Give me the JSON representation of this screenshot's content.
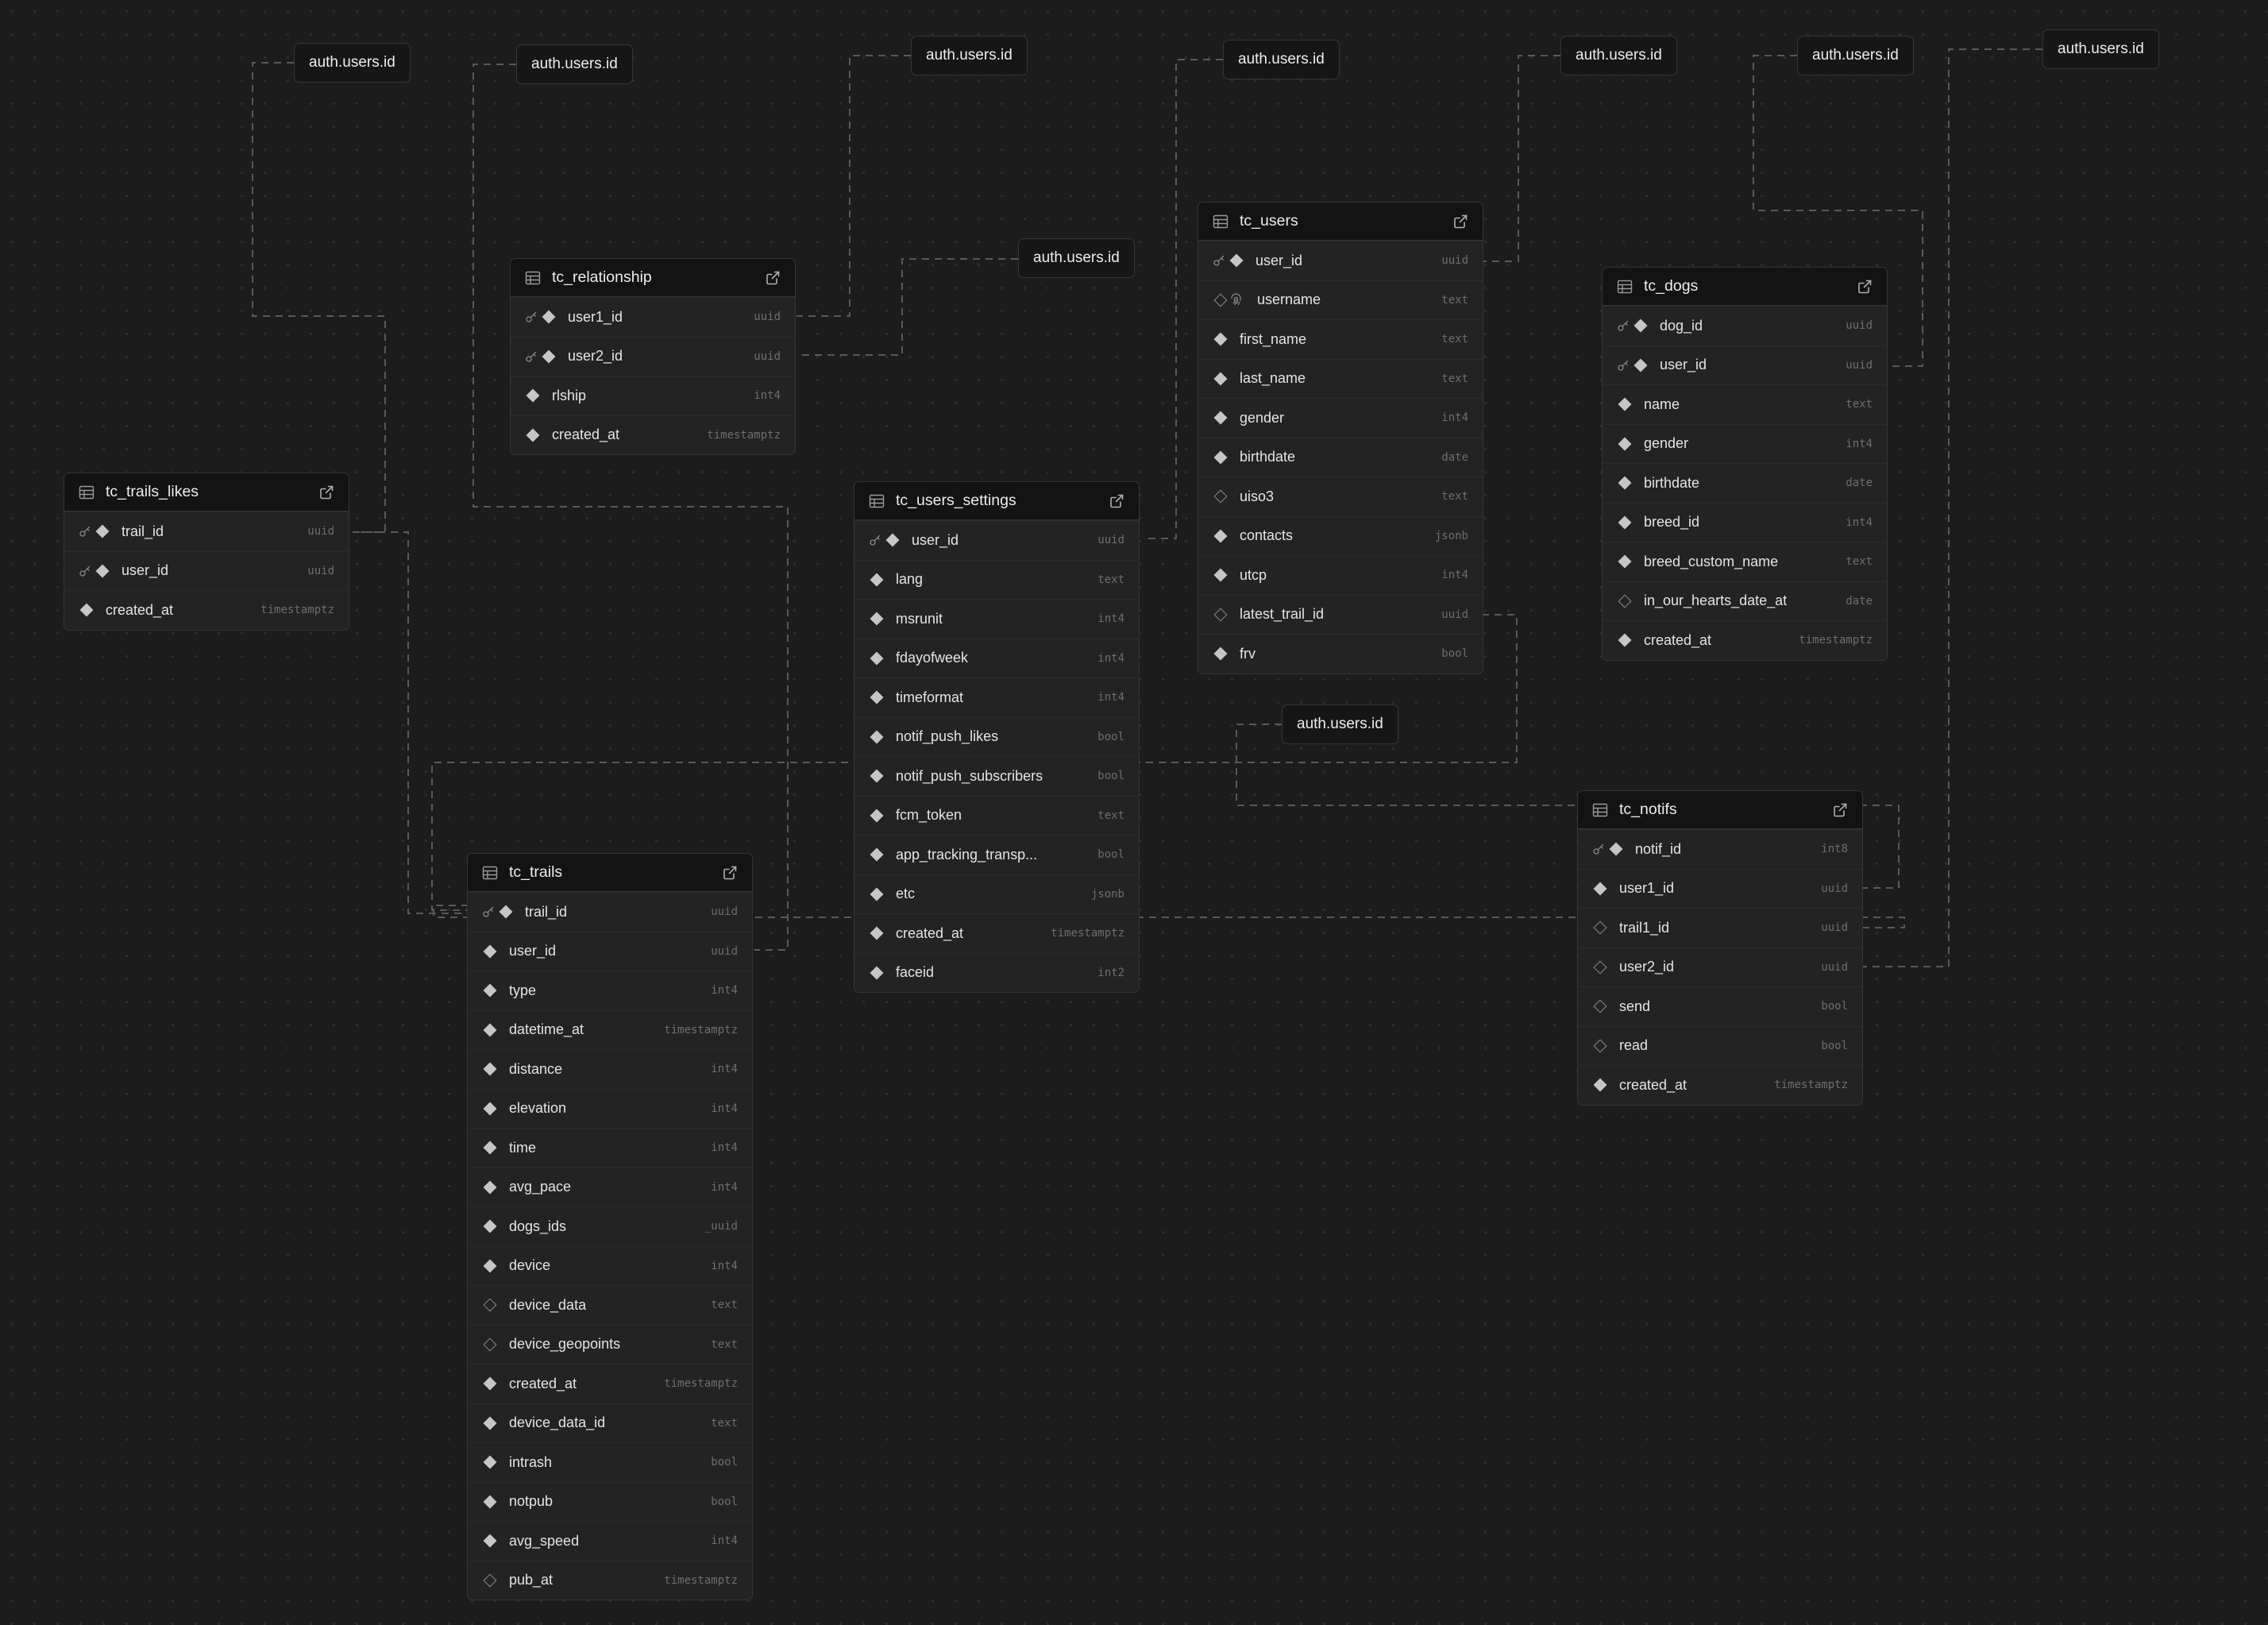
{
  "colors": {
    "background": "#1c1c1c",
    "card": "#232323",
    "card_header": "#131313",
    "border": "#353535",
    "edge": "#5a5a5a",
    "text": "#ededed",
    "type_text": "#6e6e6e"
  },
  "auth_refs": [
    "auth.users.id",
    "auth.users.id",
    "auth.users.id",
    "auth.users.id",
    "auth.users.id",
    "auth.users.id",
    "auth.users.id",
    "auth.users.id",
    "auth.users.id"
  ],
  "tables": [
    {
      "name": "tc_relationship",
      "columns": [
        {
          "name": "user1_id",
          "type": "uuid",
          "pk": true,
          "marker": "filled"
        },
        {
          "name": "user2_id",
          "type": "uuid",
          "pk": true,
          "marker": "filled"
        },
        {
          "name": "rlship",
          "type": "int4",
          "pk": false,
          "marker": "filled"
        },
        {
          "name": "created_at",
          "type": "timestamptz",
          "pk": false,
          "marker": "filled"
        }
      ]
    },
    {
      "name": "tc_users",
      "columns": [
        {
          "name": "user_id",
          "type": "uuid",
          "pk": true,
          "marker": "filled"
        },
        {
          "name": "username",
          "type": "text",
          "pk": false,
          "marker": "hollow",
          "unique_icon": "fingerprint-icon"
        },
        {
          "name": "first_name",
          "type": "text",
          "pk": false,
          "marker": "filled"
        },
        {
          "name": "last_name",
          "type": "text",
          "pk": false,
          "marker": "filled"
        },
        {
          "name": "gender",
          "type": "int4",
          "pk": false,
          "marker": "filled"
        },
        {
          "name": "birthdate",
          "type": "date",
          "pk": false,
          "marker": "filled"
        },
        {
          "name": "uiso3",
          "type": "text",
          "pk": false,
          "marker": "hollow"
        },
        {
          "name": "contacts",
          "type": "jsonb",
          "pk": false,
          "marker": "filled"
        },
        {
          "name": "utcp",
          "type": "int4",
          "pk": false,
          "marker": "filled"
        },
        {
          "name": "latest_trail_id",
          "type": "uuid",
          "pk": false,
          "marker": "hollow"
        },
        {
          "name": "frv",
          "type": "bool",
          "pk": false,
          "marker": "filled"
        }
      ]
    },
    {
      "name": "tc_dogs",
      "columns": [
        {
          "name": "dog_id",
          "type": "uuid",
          "pk": true,
          "marker": "filled"
        },
        {
          "name": "user_id",
          "type": "uuid",
          "pk": true,
          "marker": "filled"
        },
        {
          "name": "name",
          "type": "text",
          "pk": false,
          "marker": "filled"
        },
        {
          "name": "gender",
          "type": "int4",
          "pk": false,
          "marker": "filled"
        },
        {
          "name": "birthdate",
          "type": "date",
          "pk": false,
          "marker": "filled"
        },
        {
          "name": "breed_id",
          "type": "int4",
          "pk": false,
          "marker": "filled"
        },
        {
          "name": "breed_custom_name",
          "type": "text",
          "pk": false,
          "marker": "filled"
        },
        {
          "name": "in_our_hearts_date_at",
          "type": "date",
          "pk": false,
          "marker": "hollow"
        },
        {
          "name": "created_at",
          "type": "timestamptz",
          "pk": false,
          "marker": "filled"
        }
      ]
    },
    {
      "name": "tc_trails_likes",
      "columns": [
        {
          "name": "trail_id",
          "type": "uuid",
          "pk": true,
          "marker": "filled"
        },
        {
          "name": "user_id",
          "type": "uuid",
          "pk": true,
          "marker": "filled"
        },
        {
          "name": "created_at",
          "type": "timestamptz",
          "pk": false,
          "marker": "filled"
        }
      ]
    },
    {
      "name": "tc_users_settings",
      "columns": [
        {
          "name": "user_id",
          "type": "uuid",
          "pk": true,
          "marker": "filled"
        },
        {
          "name": "lang",
          "type": "text",
          "pk": false,
          "marker": "filled"
        },
        {
          "name": "msrunit",
          "type": "int4",
          "pk": false,
          "marker": "filled"
        },
        {
          "name": "fdayofweek",
          "type": "int4",
          "pk": false,
          "marker": "filled"
        },
        {
          "name": "timeformat",
          "type": "int4",
          "pk": false,
          "marker": "filled"
        },
        {
          "name": "notif_push_likes",
          "type": "bool",
          "pk": false,
          "marker": "filled"
        },
        {
          "name": "notif_push_subscribers",
          "type": "bool",
          "pk": false,
          "marker": "filled"
        },
        {
          "name": "fcm_token",
          "type": "text",
          "pk": false,
          "marker": "filled"
        },
        {
          "name": "app_tracking_transp...",
          "type": "bool",
          "pk": false,
          "marker": "filled"
        },
        {
          "name": "etc",
          "type": "jsonb",
          "pk": false,
          "marker": "filled"
        },
        {
          "name": "created_at",
          "type": "timestamptz",
          "pk": false,
          "marker": "filled"
        },
        {
          "name": "faceid",
          "type": "int2",
          "pk": false,
          "marker": "filled"
        }
      ]
    },
    {
      "name": "tc_notifs",
      "columns": [
        {
          "name": "notif_id",
          "type": "int8",
          "pk": true,
          "marker": "filled"
        },
        {
          "name": "user1_id",
          "type": "uuid",
          "pk": false,
          "marker": "filled"
        },
        {
          "name": "trail1_id",
          "type": "uuid",
          "pk": false,
          "marker": "hollow"
        },
        {
          "name": "user2_id",
          "type": "uuid",
          "pk": false,
          "marker": "hollow"
        },
        {
          "name": "send",
          "type": "bool",
          "pk": false,
          "marker": "hollow"
        },
        {
          "name": "read",
          "type": "bool",
          "pk": false,
          "marker": "hollow"
        },
        {
          "name": "created_at",
          "type": "timestamptz",
          "pk": false,
          "marker": "filled"
        }
      ]
    },
    {
      "name": "tc_trails",
      "columns": [
        {
          "name": "trail_id",
          "type": "uuid",
          "pk": true,
          "marker": "filled"
        },
        {
          "name": "user_id",
          "type": "uuid",
          "pk": false,
          "marker": "filled"
        },
        {
          "name": "type",
          "type": "int4",
          "pk": false,
          "marker": "filled"
        },
        {
          "name": "datetime_at",
          "type": "timestamptz",
          "pk": false,
          "marker": "filled"
        },
        {
          "name": "distance",
          "type": "int4",
          "pk": false,
          "marker": "filled"
        },
        {
          "name": "elevation",
          "type": "int4",
          "pk": false,
          "marker": "filled"
        },
        {
          "name": "time",
          "type": "int4",
          "pk": false,
          "marker": "filled"
        },
        {
          "name": "avg_pace",
          "type": "int4",
          "pk": false,
          "marker": "filled"
        },
        {
          "name": "dogs_ids",
          "type": "_uuid",
          "pk": false,
          "marker": "filled"
        },
        {
          "name": "device",
          "type": "int4",
          "pk": false,
          "marker": "filled"
        },
        {
          "name": "device_data",
          "type": "text",
          "pk": false,
          "marker": "hollow"
        },
        {
          "name": "device_geopoints",
          "type": "text",
          "pk": false,
          "marker": "hollow"
        },
        {
          "name": "created_at",
          "type": "timestamptz",
          "pk": false,
          "marker": "filled"
        },
        {
          "name": "device_data_id",
          "type": "text",
          "pk": false,
          "marker": "filled"
        },
        {
          "name": "intrash",
          "type": "bool",
          "pk": false,
          "marker": "filled"
        },
        {
          "name": "notpub",
          "type": "bool",
          "pk": false,
          "marker": "filled"
        },
        {
          "name": "avg_speed",
          "type": "int4",
          "pk": false,
          "marker": "filled"
        },
        {
          "name": "pub_at",
          "type": "timestamptz",
          "pk": false,
          "marker": "hollow"
        }
      ]
    }
  ]
}
